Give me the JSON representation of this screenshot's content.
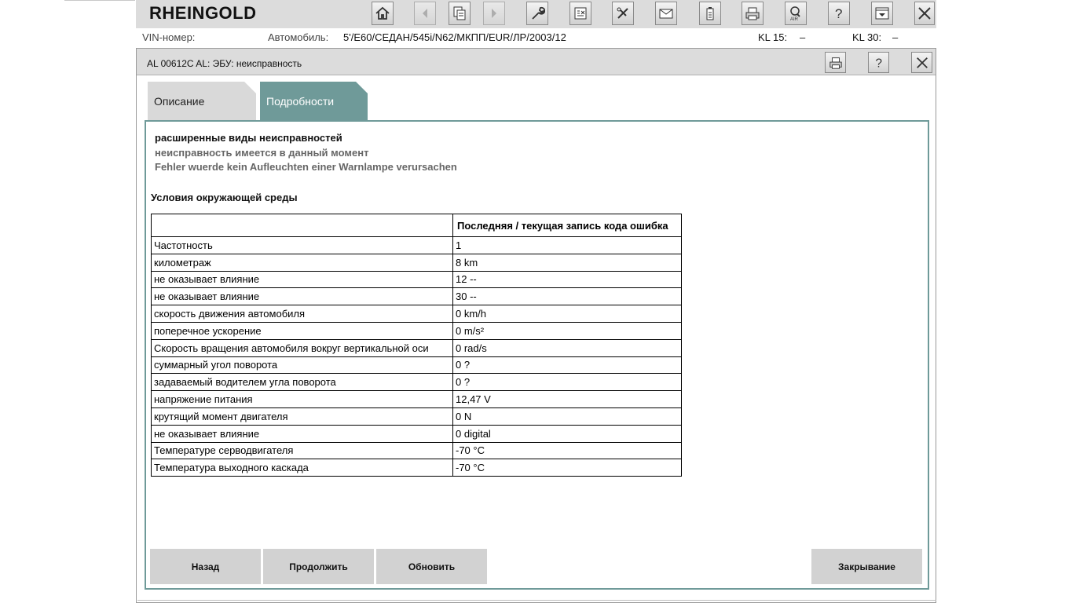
{
  "app": {
    "title": "RHEINGOLD"
  },
  "toolbar": {
    "icons": [
      "home-icon",
      "back-arrow-icon",
      "documents-icon",
      "forward-arrow-icon",
      "wrench-icon",
      "clipboard-icon",
      "tools-icon",
      "mail-icon",
      "battery-icon",
      "printer-icon",
      "air-search-icon",
      "help-icon",
      "download-icon",
      "close-icon"
    ]
  },
  "info": {
    "vin_label": "VIN-номер:",
    "vin_value": "",
    "car_label": "Автомобиль:",
    "car_value": "5'/E60/СЕДАН/545i/N62/МКПП/EUR/ЛР/2003/12",
    "kl15_label": "KL 15:",
    "kl15_value": "–",
    "kl30_label": "KL 30:",
    "kl30_value": "–"
  },
  "dialog": {
    "title": "AL 00612C AL: ЭБУ: неисправность",
    "tabs": [
      "Описание",
      "Подробности"
    ],
    "active_tab": "Подробности"
  },
  "details": {
    "fault_types_heading": "расширенные виды неисправностей",
    "fault_present": "неисправность имеется в данный момент",
    "fault_warning": "Fehler wuerde kein Aufleuchten einer Warnlampe verursachen",
    "env_heading": "Условия окружающей среды"
  },
  "table": {
    "header": [
      "",
      "Последняя / текущая запись кода ошибка"
    ],
    "rows": [
      [
        "Частотность",
        "1"
      ],
      [
        "километраж",
        "8 km"
      ],
      [
        "не оказывает влияние",
        "12 --"
      ],
      [
        "не оказывает влияние",
        "30 --"
      ],
      [
        "скорость движения автомобиля",
        "0 km/h"
      ],
      [
        "поперечное ускорение",
        "0 m/s²"
      ],
      [
        "Скорость вращения автомобиля вокруг вертикальной оси",
        "0 rad/s"
      ],
      [
        "суммарный угол поворота",
        "0 ?"
      ],
      [
        "задаваемый водителем угла поворота",
        "0 ?"
      ],
      [
        "напряжение питания",
        "12,47 V"
      ],
      [
        "крутящий момент двигателя",
        "0 N"
      ],
      [
        "не оказывает влияние",
        "0 digital"
      ],
      [
        "Температуре серводвигателя",
        "-70 °C"
      ],
      [
        "Температура выходного каскада",
        "-70 °C"
      ]
    ]
  },
  "buttons": {
    "back": "Назад",
    "continue": "Продолжить",
    "refresh": "Обновить",
    "close": "Закрывание"
  },
  "colors": {
    "accent": "#6f9a99",
    "bar": "#dcdcdc",
    "button": "#d2d2d2"
  }
}
